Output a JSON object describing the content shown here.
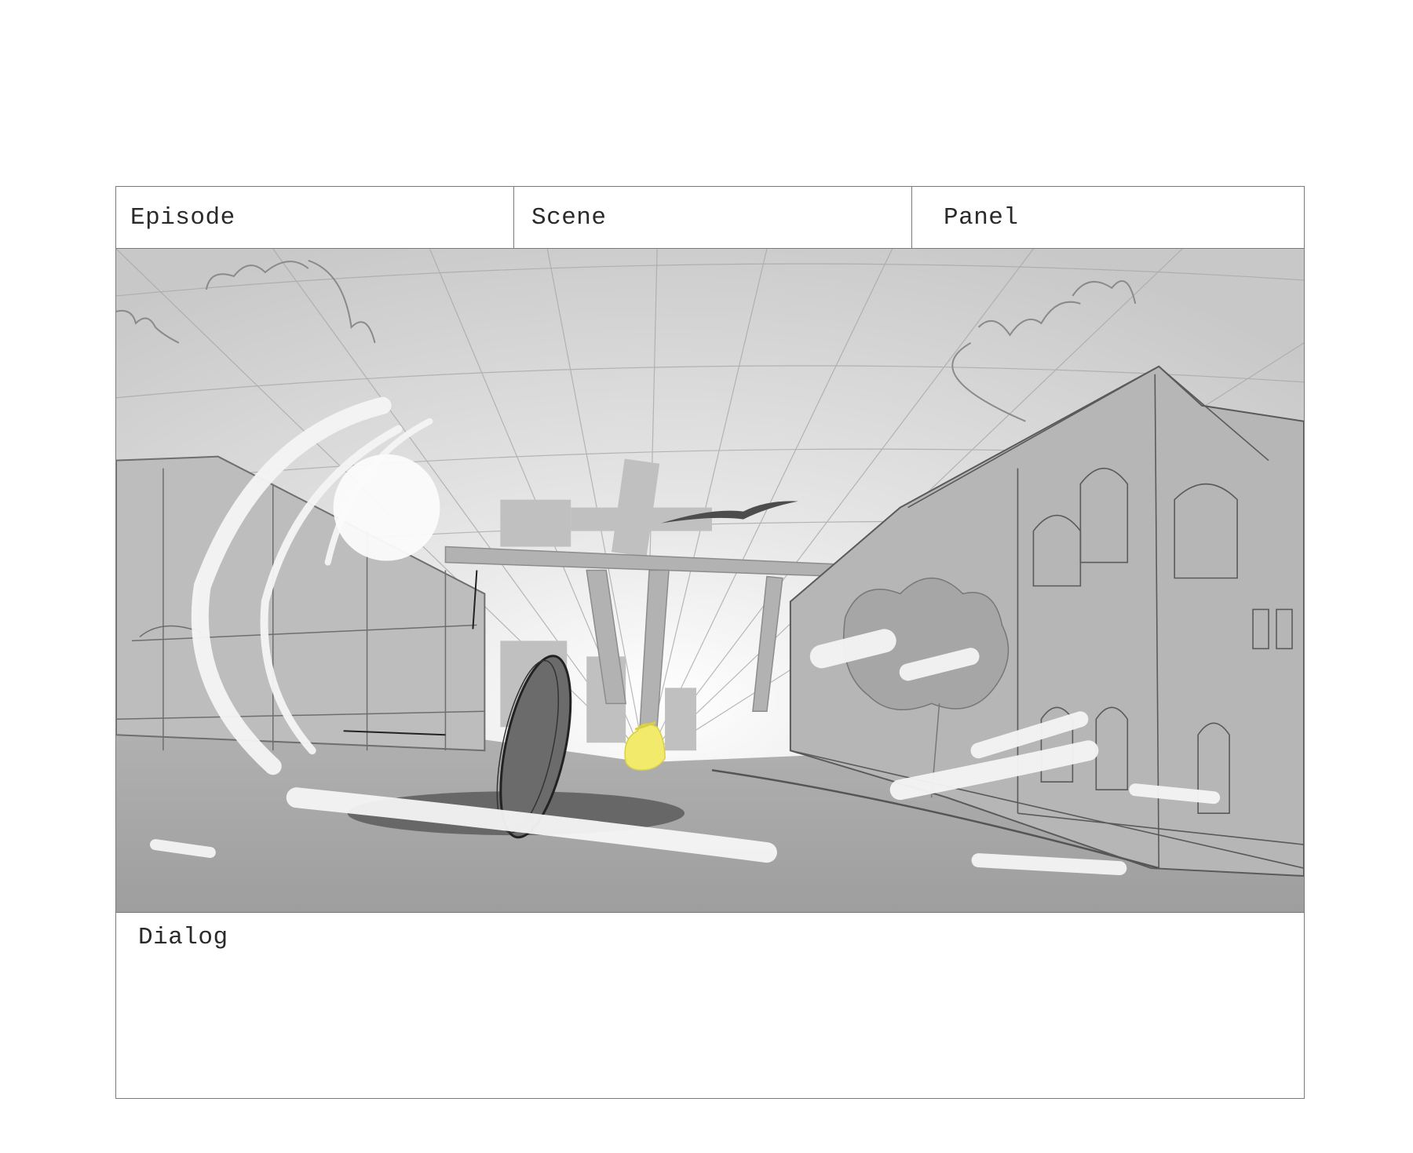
{
  "storyboard": {
    "episode_label": "Episode",
    "scene_label": "Scene",
    "panel_label": "Panel",
    "dialog_label": "Dialog"
  },
  "colors": {
    "frame_border": "#7a7a7a",
    "sketch_gray": "#9a9a9a",
    "highlight_yellow": "#f2ea6a"
  }
}
